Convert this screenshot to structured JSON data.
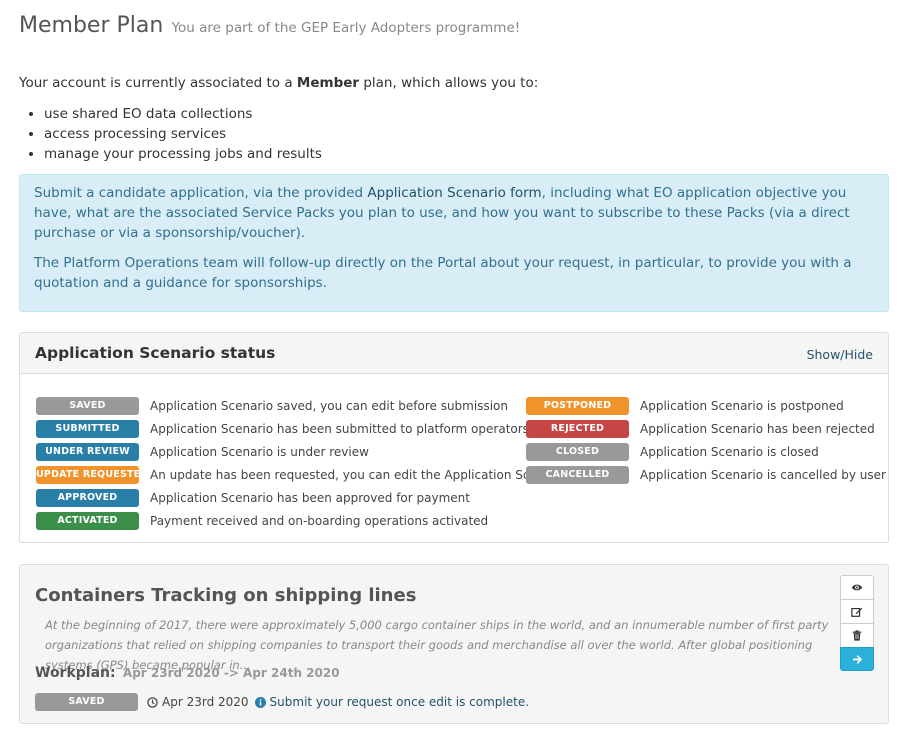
{
  "header": {
    "title": "Member Plan",
    "subtitle": "You are part of the GEP Early Adopters programme!"
  },
  "intro": {
    "before": "Your account is currently associated to a ",
    "plan": "Member",
    "after": " plan, which allows you to:"
  },
  "permissions": [
    "use shared EO data collections",
    "access processing services",
    "manage your processing jobs and results"
  ],
  "info_alert": {
    "p1_before": "Submit a candidate application, via the provided ",
    "p1_link": "Application Scenario form",
    "p1_after": ", including what EO application objective you have, what are the associated Service Packs you plan to use, and how you want to subscribe to these Packs (via a direct purchase or via a sponsorship/voucher).",
    "p2": "The Platform Operations team will follow-up directly on the Portal about your request, in particular, to provide you with a quotation and a guidance for sponsorships."
  },
  "status_panel": {
    "title": "Application Scenario status",
    "toggle": "Show/Hide",
    "left": [
      {
        "badge": "SAVED",
        "color": "#999999",
        "desc": "Application Scenario saved, you can edit before submission"
      },
      {
        "badge": "SUBMITTED",
        "color": "#2a7fa8",
        "desc": "Application Scenario has been submitted to platform operators"
      },
      {
        "badge": "UNDER REVIEW",
        "color": "#2a7fa8",
        "desc": "Application Scenario is under review"
      },
      {
        "badge": "UPDATE REQUESTED",
        "color": "#f0932b",
        "desc": "An update has been requested, you can edit the Application Scenario"
      },
      {
        "badge": "APPROVED",
        "color": "#2a7fa8",
        "desc": "Application Scenario has been approved for payment"
      },
      {
        "badge": "ACTIVATED",
        "color": "#3c8f4a",
        "desc": "Payment received and on-boarding operations activated"
      }
    ],
    "right": [
      {
        "badge": "POSTPONED",
        "color": "#f0932b",
        "desc": "Application Scenario is postponed"
      },
      {
        "badge": "REJECTED",
        "color": "#c64545",
        "desc": "Application Scenario has been rejected"
      },
      {
        "badge": "CLOSED",
        "color": "#999999",
        "desc": "Application Scenario is closed"
      },
      {
        "badge": "CANCELLED",
        "color": "#999999",
        "desc": "Application Scenario is cancelled by user"
      }
    ]
  },
  "scenario_card": {
    "title": "Containers Tracking on shipping lines",
    "description": "At the beginning of 2017, there were approximately 5,000 cargo container ships in the world, and an innumerable number of first party organizations that relied on shipping companies to transport their goods and merchandise all over the world. After global positioning systems (GPS) became popular in...",
    "workplan_label": "Workplan:",
    "workplan_dates": "Apr 23rd 2020 -> Apr 24th 2020",
    "status_badge": "SAVED",
    "status_color": "#999999",
    "date": "Apr 23rd 2020",
    "hint": "Submit your request once edit is complete.",
    "actions": [
      "eye-icon",
      "edit-icon",
      "trash-icon",
      "arrow-right-icon"
    ]
  }
}
